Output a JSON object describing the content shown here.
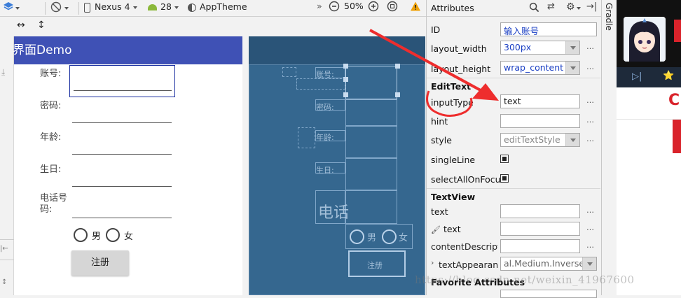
{
  "toolbar": {
    "device": "Nexus 4",
    "api_level": "28",
    "theme": "AppTheme",
    "zoom": "50%",
    "more": "»"
  },
  "preview": {
    "title": "界面Demo",
    "fields": [
      {
        "label": "账号:"
      },
      {
        "label": "密码:"
      },
      {
        "label": "年龄:"
      },
      {
        "label": "生日:"
      },
      {
        "label": "电话号\n码:"
      }
    ],
    "radio_male": "男",
    "radio_female": "女",
    "register_button": "注册"
  },
  "blueprint": {
    "labels": [
      "账号:",
      "密码:",
      "年龄:",
      "生日:"
    ],
    "phone_label": "电话",
    "radio_male": "男",
    "radio_female": "女",
    "register_button": "注册"
  },
  "attributes": {
    "title": "Attributes",
    "rows": {
      "id_label": "ID",
      "id_value": "输入账号",
      "layout_width_label": "layout_width",
      "layout_width_value": "300px",
      "layout_height_label": "layout_height",
      "layout_height_value": "wrap_content",
      "section_edittext": "EditText",
      "input_type_label": "inputType",
      "input_type_value": "text",
      "hint_label": "hint",
      "style_label": "style",
      "style_value": "editTextStyle",
      "single_line_label": "singleLine",
      "select_all_label": "selectAllOnFocus",
      "section_textview": "TextView",
      "text_label": "text",
      "text_tools_label": "text",
      "content_desc_label": "contentDescription",
      "text_appearance_label": "textAppearance",
      "text_appearance_value": "al.Medium.Inverse",
      "section_favorite": "Favorite Attributes"
    },
    "dots": "…"
  },
  "gradle": {
    "label": "Gradle"
  },
  "watermark": "https://blog.csdn.net/weixin_41967600",
  "colors": {
    "appbar": "#3f51b5",
    "id_value_text": "#1a3fc4",
    "blueprint": "#35678f",
    "annotation_red": "#ee2d2d"
  }
}
